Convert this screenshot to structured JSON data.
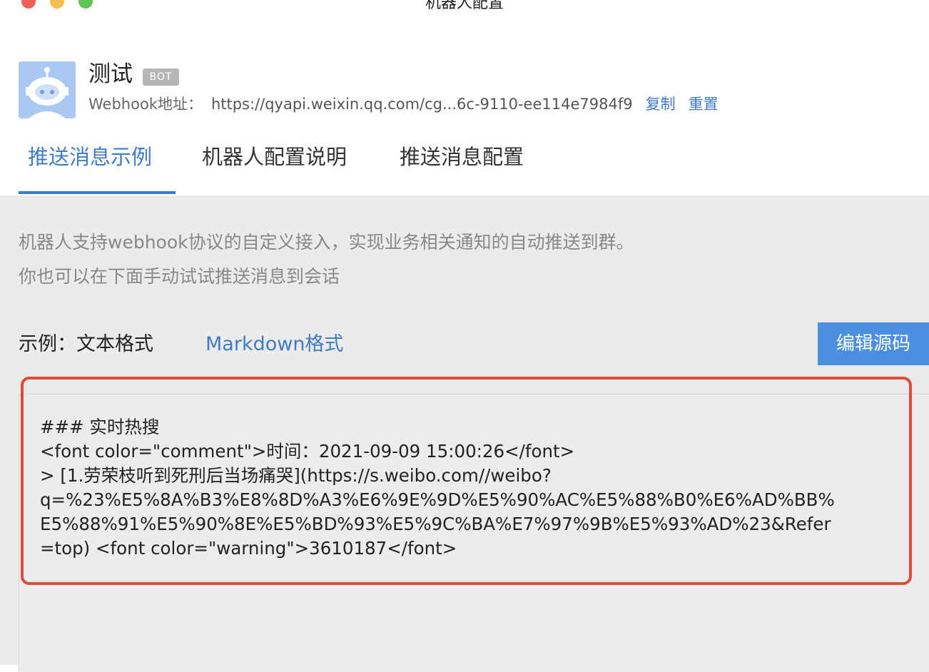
{
  "window": {
    "title": "机器人配置"
  },
  "bot": {
    "name": "测试",
    "badge": "BOT",
    "webhook_label": "Webhook地址：",
    "webhook_url": "https://qyapi.weixin.qq.com/cg...6c-9110-ee114e7984f9",
    "copy_label": "复制",
    "reset_label": "重置",
    "avatar_icon": "robot-avatar-icon"
  },
  "tabs": [
    {
      "label": "推送消息示例",
      "active": true
    },
    {
      "label": "机器人配置说明",
      "active": false
    },
    {
      "label": "推送消息配置",
      "active": false
    }
  ],
  "content": {
    "description_line1": "机器人支持webhook协议的自定义接入，实现业务相关通知的自动推送到群。",
    "description_line2": "你也可以在下面手动试试推送消息到会话",
    "example_label": "示例：文本格式",
    "markdown_link": "Markdown格式",
    "edit_button": "编辑源码",
    "code_lines": [
      "### 实时热搜",
      "<font color=\"comment\">时间：2021-09-09 15:00:26</font>",
      "> [1.劳荣枝听到死刑后当场痛哭](https://s.weibo.com//weibo?",
      "q=%23%E5%8A%B3%E8%8D%A3%E6%9E%9D%E5%90%AC%E5%88%B0%E6%AD%BB%",
      "E5%88%91%E5%90%8E%E5%BD%93%E5%9C%BA%E7%97%9B%E5%93%AD%23&Refer",
      "=top) <font color=\"warning\">3610187</font>"
    ]
  },
  "colors": {
    "accent": "#3f7cc5",
    "button": "#4a8fe0",
    "highlight_border": "#e14a36",
    "content_bg": "#ebebeb"
  }
}
